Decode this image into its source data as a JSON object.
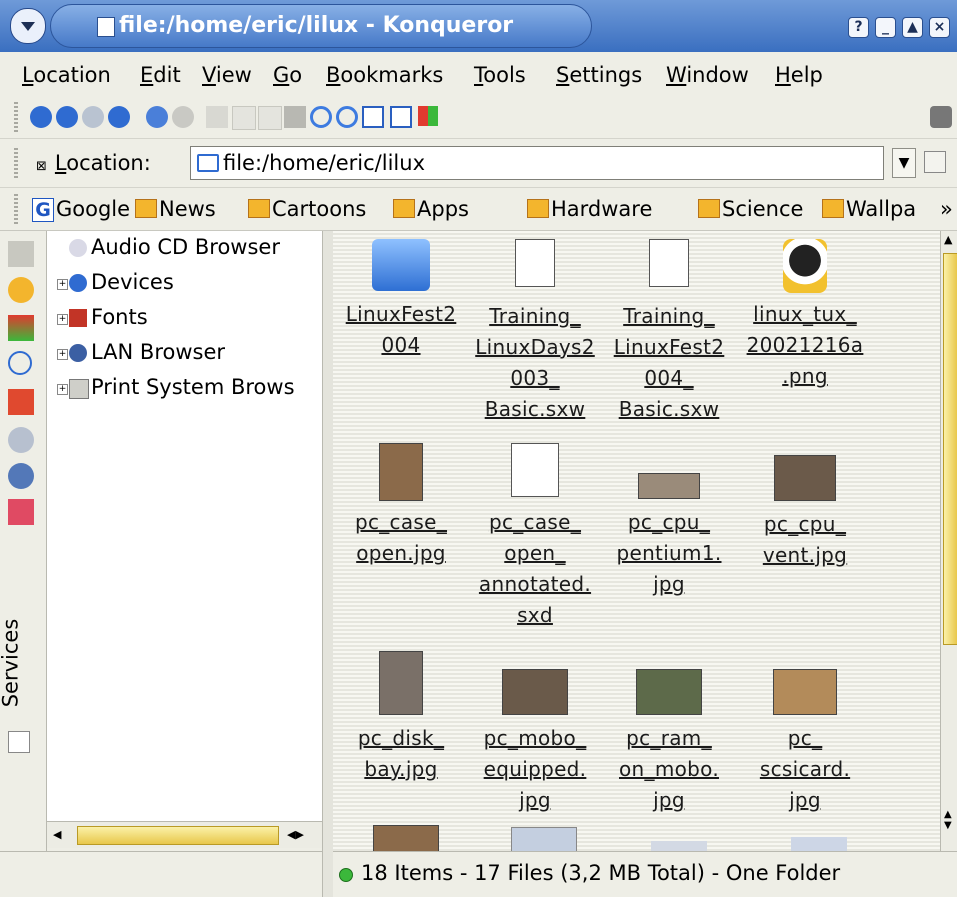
{
  "window": {
    "title": "file:/home/eric/lilux - Konqueror"
  },
  "menubar": {
    "items": [
      {
        "mnemonic": "L",
        "rest": "ocation"
      },
      {
        "mnemonic": "E",
        "rest": "dit"
      },
      {
        "mnemonic": "V",
        "rest": "iew"
      },
      {
        "mnemonic": "G",
        "rest": "o"
      },
      {
        "mnemonic": "B",
        "rest": "ookmarks"
      },
      {
        "mnemonic": "T",
        "rest": "ools"
      },
      {
        "mnemonic": "S",
        "rest": "ettings"
      },
      {
        "mnemonic": "W",
        "rest": "indow"
      },
      {
        "mnemonic": "H",
        "rest": "elp"
      }
    ]
  },
  "location": {
    "label_prefix": "L",
    "label_rest": "ocation:",
    "value": "file:/home/eric/lilux"
  },
  "bookmarks": {
    "items": [
      "Google",
      "News",
      "Cartoons",
      "Apps",
      "Hardware",
      "Science",
      "Wallpa"
    ],
    "more": "»"
  },
  "sidebar": {
    "services_label": "Services"
  },
  "tree": {
    "items": [
      {
        "label": "Audio CD Browser",
        "icon": "audio-cd-icon"
      },
      {
        "label": "Devices",
        "icon": "devices-icon"
      },
      {
        "label": "Fonts",
        "icon": "fonts-icon"
      },
      {
        "label": "LAN Browser",
        "icon": "lan-icon"
      },
      {
        "label": "Print System Brows",
        "icon": "printer-icon"
      }
    ]
  },
  "files": [
    {
      "lines": [
        "LinuxFest2",
        "004"
      ],
      "kind": "folder"
    },
    {
      "lines": [
        "Training_",
        "LinuxDays2",
        "003_",
        "Basic.sxw"
      ],
      "kind": "doc"
    },
    {
      "lines": [
        "Training_",
        "LinuxFest2",
        "004_",
        "Basic.sxw"
      ],
      "kind": "doc"
    },
    {
      "lines": [
        "linux_tux_",
        "20021216a",
        ".png"
      ],
      "kind": "tux"
    },
    {
      "lines": [
        "pc_case_",
        "open.jpg"
      ],
      "kind": "photo"
    },
    {
      "lines": [
        "pc_case_",
        "open_",
        "annotated.",
        "sxd"
      ],
      "kind": "draw"
    },
    {
      "lines": [
        "pc_cpu_",
        "pentium1.",
        "jpg"
      ],
      "kind": "photo"
    },
    {
      "lines": [
        "pc_cpu_",
        "vent.jpg"
      ],
      "kind": "photo"
    },
    {
      "lines": [
        "pc_disk_",
        "bay.jpg"
      ],
      "kind": "photo"
    },
    {
      "lines": [
        "pc_mobo_",
        "equipped.",
        "jpg"
      ],
      "kind": "photo"
    },
    {
      "lines": [
        "pc_ram_",
        "on_mobo.",
        "jpg"
      ],
      "kind": "photo"
    },
    {
      "lines": [
        "pc_",
        "scsicard.",
        "jpg"
      ],
      "kind": "photo"
    }
  ],
  "status": {
    "text": "18 Items - 17 Files (3,2 MB Total) - One Folder"
  }
}
